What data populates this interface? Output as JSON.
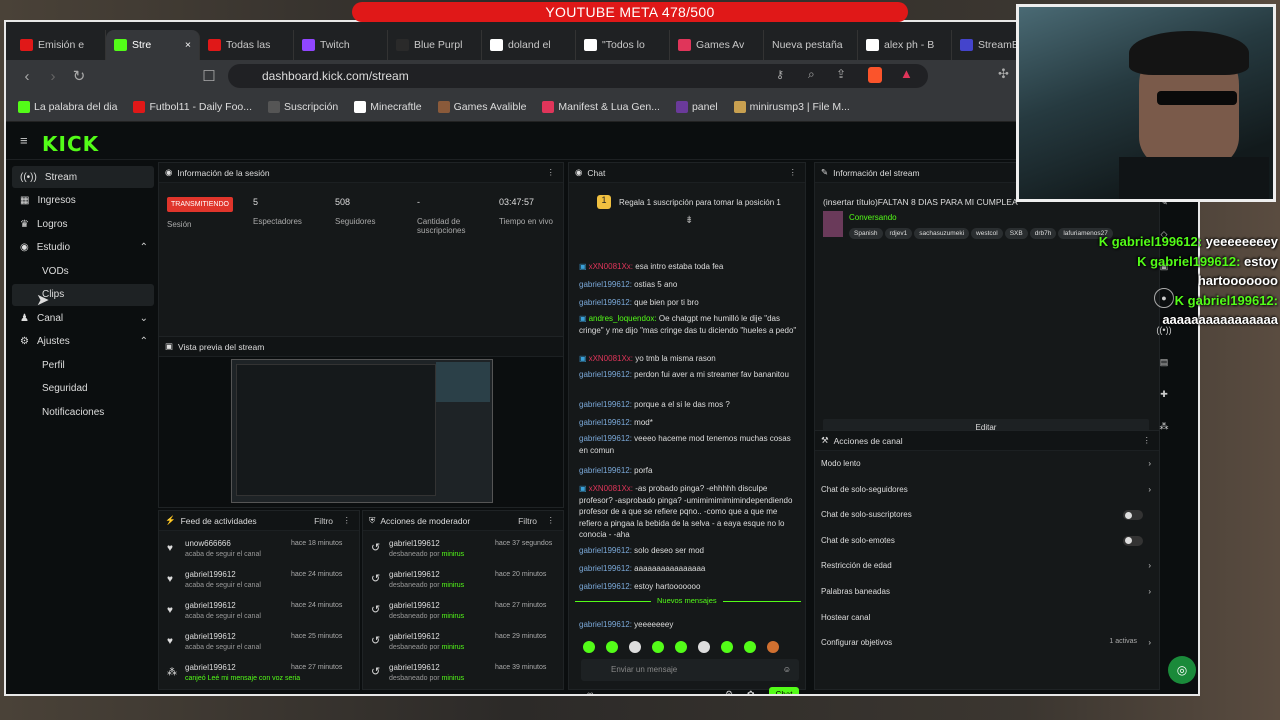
{
  "overlay": {
    "goal": "YOUTUBE META 478/500"
  },
  "tabs": [
    {
      "label": "Emisión e",
      "icon": "youtube-icon"
    },
    {
      "label": "Stre",
      "icon": "kick-icon",
      "active": true
    },
    {
      "label": "Todas las",
      "icon": "youtube-icon"
    },
    {
      "label": "Twitch",
      "icon": "twitch-icon"
    },
    {
      "label": "Blue Purpl",
      "icon": "globe-icon"
    },
    {
      "label": "doland el",
      "icon": "google-icon"
    },
    {
      "label": "\"Todos lo",
      "icon": "page-icon"
    },
    {
      "label": "Games Av",
      "icon": "games-icon"
    },
    {
      "label": "Nueva pestaña",
      "icon": ""
    },
    {
      "label": "alex ph - B",
      "icon": "google-icon"
    },
    {
      "label": "StreamEle",
      "icon": "streamelements-icon"
    }
  ],
  "address": {
    "url": "dashboard.kick.com/stream"
  },
  "bookmarks": [
    "La palabra del dia",
    "Futbol11 - Daily Foo...",
    "Suscripción",
    "Minecraftle",
    "Games Avalible",
    "Manifest & Lua Gen...",
    "panel",
    "minirusmp3 | File M..."
  ],
  "kick": {
    "logo": "KICK"
  },
  "sidebar": {
    "stream": "Stream",
    "ingresos": "Ingresos",
    "logros": "Logros",
    "estudio": "Estudio",
    "vods": "VODs",
    "clips": "Clips",
    "canal": "Canal",
    "ajustes": "Ajustes",
    "perfil": "Perfil",
    "seguridad": "Seguridad",
    "notificaciones": "Notificaciones"
  },
  "session": {
    "title": "Información de la sesión",
    "status": "TRANSMITIENDO",
    "status_label": "Sesión",
    "viewers": "5",
    "viewers_label": "Espectadores",
    "followers": "508",
    "followers_label": "Seguidores",
    "subs": "-",
    "subs_label": "Cantidad de suscripciones",
    "uptime": "03:47:57",
    "uptime_label": "Tiempo en vivo"
  },
  "preview": {
    "title": "Vista previa del stream"
  },
  "feed": {
    "title": "Feed de actividades",
    "filter": "Filtro",
    "items": [
      {
        "user": "unow666666",
        "action": "acaba de seguir el canal",
        "time": "hace 18 minutos"
      },
      {
        "user": "gabriel199612",
        "action": "acaba de seguir el canal",
        "time": "hace 24 minutos"
      },
      {
        "user": "gabriel199612",
        "action": "acaba de seguir el canal",
        "time": "hace 24 minutos"
      },
      {
        "user": "gabriel199612",
        "action": "acaba de seguir el canal",
        "time": "hace 25 minutos"
      },
      {
        "user": "gabriel199612",
        "action": "canjeó Leé mi mensaje con voz seria",
        "time": "hace 27 minutos"
      }
    ]
  },
  "mod": {
    "title": "Acciones de moderador",
    "filter": "Filtro",
    "items": [
      {
        "user": "gabriel199612",
        "action": "desbaneado por",
        "by": "minirus",
        "time": "hace 37 segundos"
      },
      {
        "user": "gabriel199612",
        "action": "desbaneado por",
        "by": "minirus",
        "time": "hace 20 minutos"
      },
      {
        "user": "gabriel199612",
        "action": "desbaneado por",
        "by": "minirus",
        "time": "hace 27 minutos"
      },
      {
        "user": "gabriel199612",
        "action": "desbaneado por",
        "by": "minirus",
        "time": "hace 29 minutos"
      },
      {
        "user": "gabriel199612",
        "action": "desbaneado por",
        "by": "minirus",
        "time": "hace 39 minutos"
      }
    ]
  },
  "chat": {
    "title": "Chat",
    "gift_banner": "Regala 1 suscripción para tomar la posición 1",
    "new_messages": "Nuevos mensajes",
    "placeholder": "Enviar un mensaje",
    "send": "Chat",
    "messages": [
      {
        "user": "xXN0081Xx:",
        "text": "esa intro estaba toda fea",
        "color": "u2"
      },
      {
        "user": "gabriel199612:",
        "text": "ostias 5 ano",
        "color": "u1"
      },
      {
        "user": "gabriel199612:",
        "text": "que bien por ti bro",
        "color": "u1"
      },
      {
        "user": "andres_loquendox:",
        "text": "Oe chatgpt me humilló le dije \"das cringe\" y me dijo \"mas cringe das tu diciendo \"hueles a pedo\"",
        "color": "u3"
      },
      {
        "user": "xXN0081Xx:",
        "text": "yo tmb la misma rason",
        "color": "u2"
      },
      {
        "user": "gabriel199612:",
        "text": "perdon fui aver a mi streamer fav bananitou",
        "color": "u1"
      },
      {
        "user": "gabriel199612:",
        "text": "porque a el si le das mos ?",
        "color": "u1"
      },
      {
        "user": "gabriel199612:",
        "text": "mod*",
        "color": "u1"
      },
      {
        "user": "gabriel199612:",
        "text": "veeeo haceme mod tenemos muchas cosas en comun",
        "color": "u1"
      },
      {
        "user": "gabriel199612:",
        "text": "porfa",
        "color": "u1"
      },
      {
        "user": "xXN0081Xx:",
        "text": "-as probado pinga? -ehhhhh disculpe profesor? -asprobado pinga? -umimimimimimindependiendo profesor de a que se refiere pqno.. -como que a que me refiero a pingaa la bebida de la selva - a eaya esque no lo conocia - -aha",
        "color": "u2"
      },
      {
        "user": "gabriel199612:",
        "text": "solo deseo ser mod",
        "color": "u1"
      },
      {
        "user": "gabriel199612:",
        "text": "aaaaaaaaaaaaaaaa",
        "color": "u1"
      },
      {
        "user": "gabriel199612:",
        "text": "estoy hartooooooo",
        "color": "u1"
      }
    ],
    "after_new": {
      "user": "gabriel199612:",
      "text": "yeeeeeeey"
    }
  },
  "streaminfo": {
    "title": "Información del stream",
    "stream_title": "(insertar título)FALTAN 8 DIAS PARA MI CUMPLEA",
    "category": "Conversando",
    "tags": [
      "Spanish",
      "rdjev1",
      "sachasuzumeki",
      "westcol",
      "SXB",
      "drb7h",
      "lafuriamenos27"
    ],
    "edit": "Editar"
  },
  "channel": {
    "title": "Acciones de canal",
    "rows": [
      {
        "label": "Modo lento",
        "kind": "chevron"
      },
      {
        "label": "Chat de solo-seguidores",
        "kind": "chevron"
      },
      {
        "label": "Chat de solo-suscriptores",
        "kind": "toggle"
      },
      {
        "label": "Chat de solo-emotes",
        "kind": "toggle"
      },
      {
        "label": "Restricción de edad",
        "kind": "chevron"
      },
      {
        "label": "Palabras baneadas",
        "kind": "chevron"
      },
      {
        "label": "Hostear canal",
        "kind": "none"
      },
      {
        "label": "Configurar objetivos",
        "kind": "chevron",
        "extra": "1 activas"
      }
    ]
  },
  "overlay_chat": [
    {
      "user": "gabriel199612:",
      "text": " yeeeeeeeey"
    },
    {
      "user": "gabriel199612:",
      "text": " estoy hartooooooo"
    },
    {
      "user": "gabriel199612:",
      "text": " aaaaaaaaaaaaaaaa"
    }
  ],
  "colors": {
    "kick_green": "#53fc18",
    "live_red": "#e0352b",
    "goal_red": "#e01818"
  }
}
